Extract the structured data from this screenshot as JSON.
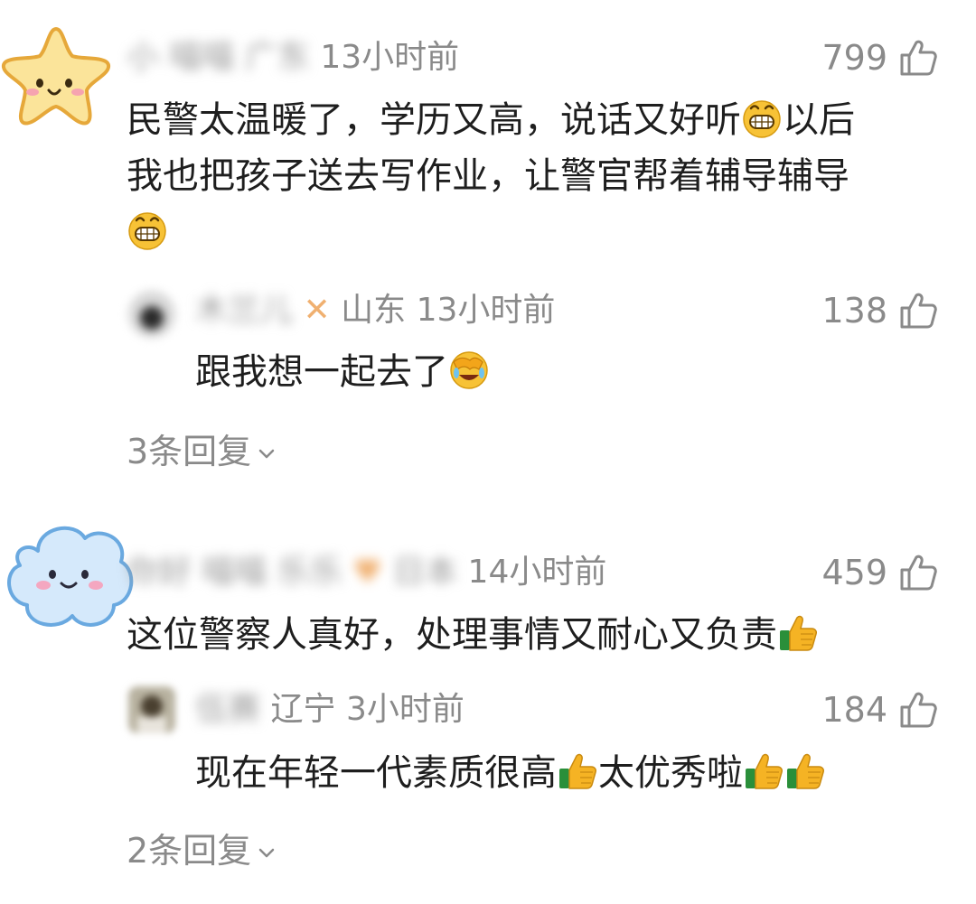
{
  "comments": [
    {
      "username": "小 喵喵",
      "location": "广东",
      "time": "13小时前",
      "likes": "799",
      "text_line1": "民警太温暖了，学历又高，说话又好听",
      "text_line1_after": "以后",
      "text_line2": "我也把孩子送去写作业，让警官帮着辅导辅导",
      "reply": {
        "username": "木兰儿",
        "location": "山东",
        "time": "13小时前",
        "likes": "138",
        "text": "跟我想一起去了"
      },
      "reply_count": "3条回复"
    },
    {
      "username": "你好 喵喵 乐乐",
      "location": "日本",
      "time": "14小时前",
      "likes": "459",
      "text": "这位警察人真好，处理事情又耐心又负责",
      "reply": {
        "username": "伍赛",
        "location": "辽宁",
        "time": "3小时前",
        "likes": "184",
        "text_part1": "现在年轻一代素质很高",
        "text_part2": "太优秀啦"
      },
      "reply_count": "2条回复"
    }
  ],
  "icons": {
    "like": "thumbs-up-outline-icon",
    "grin": "grinning-emoji-icon",
    "facepalm": "laughing-facepalm-emoji-icon",
    "thumbs": "thumbs-up-emoji-icon",
    "chevron": "chevron-down-icon"
  }
}
